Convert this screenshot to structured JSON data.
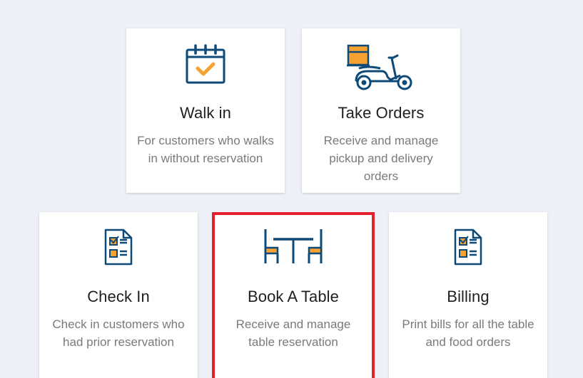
{
  "cards": [
    {
      "id": "walk-in",
      "title": "Walk in",
      "description": "For customers who walks in without reservation",
      "icon": "calendar-check-icon"
    },
    {
      "id": "take-orders",
      "title": "Take Orders",
      "description": "Receive and manage pickup and delivery orders",
      "icon": "delivery-scooter-icon"
    },
    {
      "id": "check-in",
      "title": "Check In",
      "description": "Check in customers who had prior reservation",
      "icon": "checklist-document-icon"
    },
    {
      "id": "book-table",
      "title": "Book A Table",
      "description": "Receive and manage table reservation",
      "icon": "table-chairs-icon",
      "highlighted": true
    },
    {
      "id": "billing",
      "title": "Billing",
      "description": "Print bills for all the table and food orders",
      "icon": "bill-document-icon"
    }
  ],
  "colors": {
    "icon_blue": "#0e4a78",
    "icon_orange": "#f5a232",
    "highlight": "#e3202b",
    "background": "#edf0f7"
  }
}
